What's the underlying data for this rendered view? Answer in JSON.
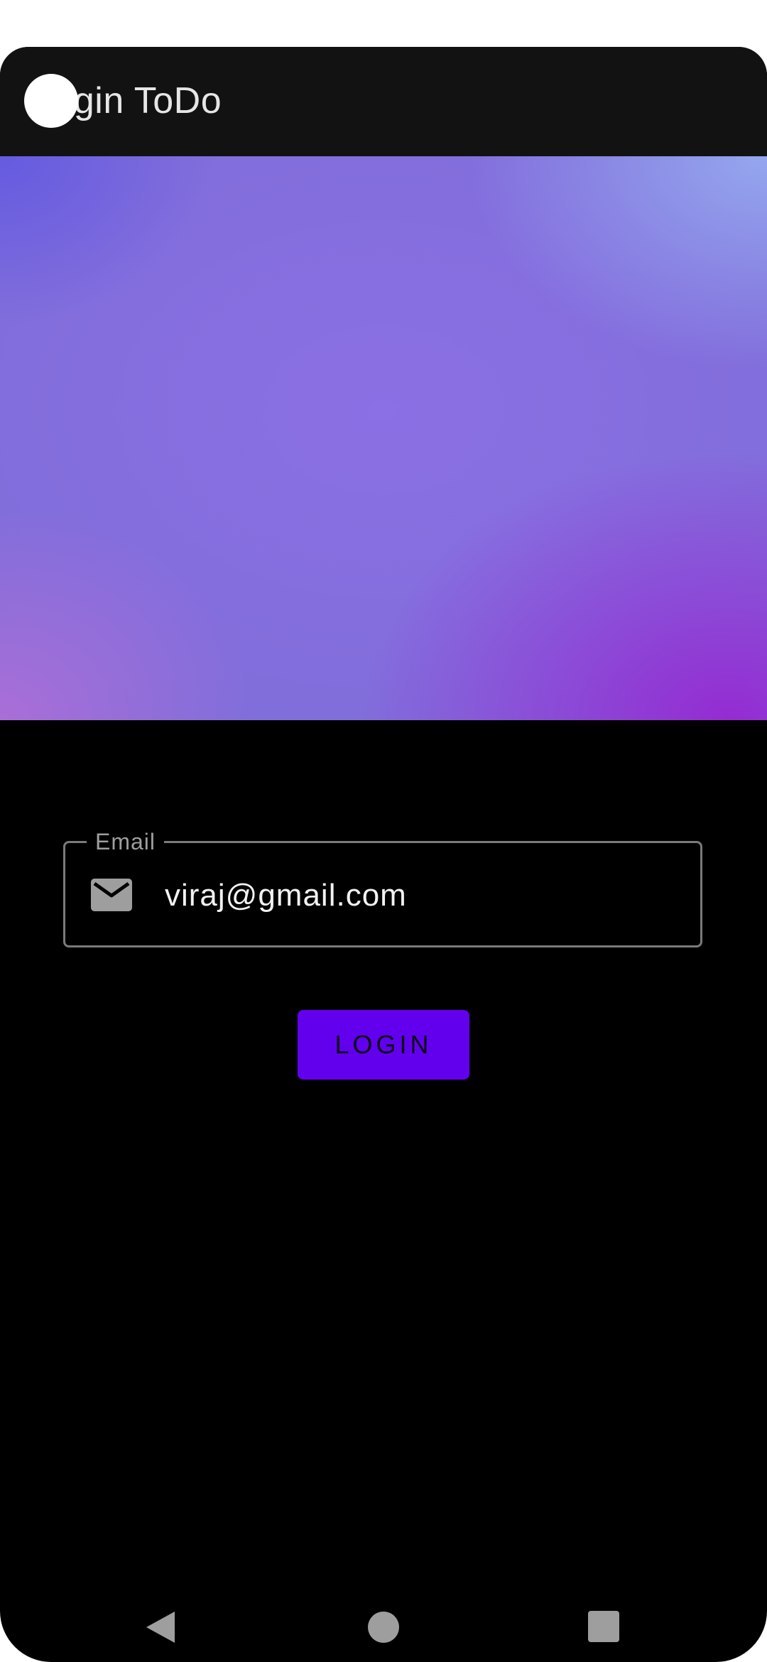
{
  "app_bar": {
    "title": "Login ToDo"
  },
  "login_form": {
    "email": {
      "label": "Email",
      "value": "viraj@gmail.com",
      "icon": "mail-icon"
    },
    "login_button_label": "LOGIN"
  },
  "navigation_bar": {
    "back_icon": "back-triangle-icon",
    "home_icon": "home-circle-icon",
    "recents_icon": "recents-square-icon"
  },
  "colors": {
    "background": "#000000",
    "app_bar": "#121212",
    "primary_button": "#6200ee",
    "hero_gradient_main": "#8b6fe4",
    "hero_gradient_accent": "#9628d2",
    "field_outline": "#7a7a7a",
    "nav_icons": "#9e9e9e"
  }
}
